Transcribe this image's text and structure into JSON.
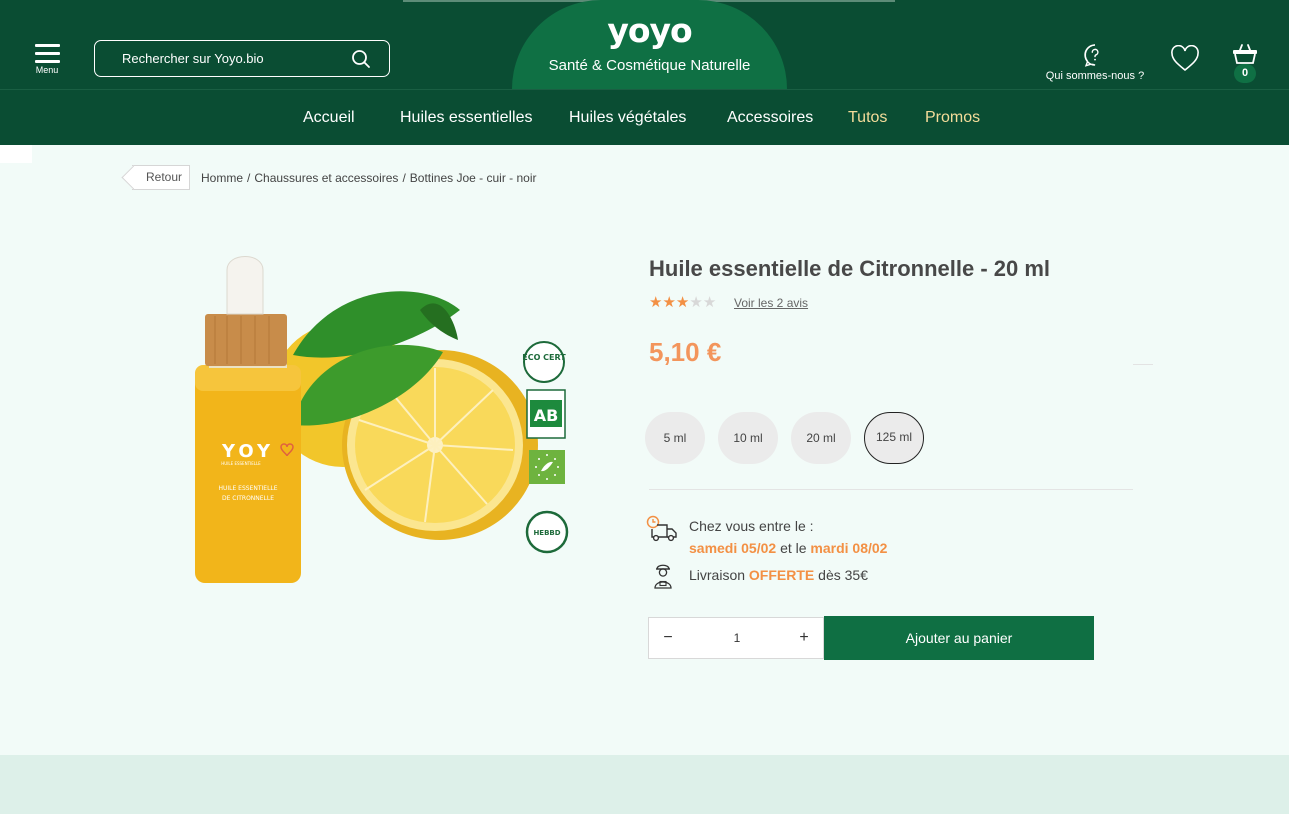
{
  "header": {
    "menu_label": "Menu",
    "search_placeholder": "Rechercher sur Yoyo.bio",
    "logo": "yoyo",
    "tagline": "Santé & Cosmétique Naturelle",
    "about_label": "Qui sommes-nous ?",
    "cart_count": "0"
  },
  "nav": {
    "items": [
      "Accueil",
      "Huiles essentielles",
      "Huiles végétales",
      "Accessoires",
      "Tutos",
      "Promos"
    ],
    "accent_color": "#f4dc9a"
  },
  "breadcrumb": {
    "back": "Retour",
    "items": [
      "Homme",
      "Chaussures et accessoires",
      "Bottines Joe - cuir - noir"
    ]
  },
  "product": {
    "title": "Huile essentielle de Citronnelle - 20 ml",
    "rating": 3,
    "rating_max": 5,
    "reviews_link": "Voir les 2 avis",
    "price": "5,10 €",
    "variants": [
      "5 ml",
      "10 ml",
      "20 ml",
      "125 ml"
    ],
    "selected_variant": "125 ml",
    "image": {
      "bottle_brand": "YOY",
      "bottle_subtitle": "HUILE ESSENTIELLE",
      "bottle_label": [
        "HUILE ESSENTIELLE",
        "DE CITRONNELLE"
      ],
      "badges": [
        "ECO CERT",
        "AB",
        "EU organic",
        "HEBBD"
      ]
    }
  },
  "delivery": {
    "prefix": "Chez vous entre le :",
    "date1": "samedi 05/02",
    "middle": "et le",
    "date2": "mardi 08/02",
    "free_prefix": "Livraison",
    "free_word": "OFFERTE",
    "free_suffix": "dès 35€"
  },
  "cart": {
    "quantity": "1",
    "minus": "−",
    "plus": "+",
    "add_label": "Ajouter au panier"
  },
  "colors": {
    "header_bg": "#0a4d33",
    "brand_green": "#0f7044",
    "price_orange": "#f3955c",
    "star": "#f39044"
  }
}
